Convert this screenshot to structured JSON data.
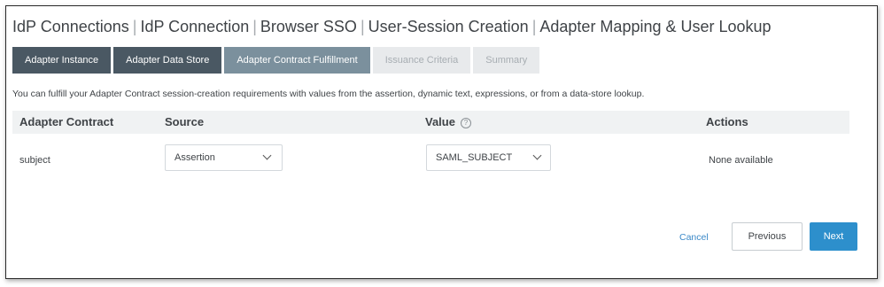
{
  "breadcrumb": {
    "items": [
      "IdP Connections",
      "IdP Connection",
      "Browser SSO",
      "User-Session Creation",
      "Adapter Mapping & User Lookup"
    ],
    "separator": "|"
  },
  "tabs": [
    {
      "label": "Adapter Instance",
      "state": "done"
    },
    {
      "label": "Adapter Data Store",
      "state": "done"
    },
    {
      "label": "Adapter Contract Fulfillment",
      "state": "active"
    },
    {
      "label": "Issuance Criteria",
      "state": "pending"
    },
    {
      "label": "Summary",
      "state": "pending"
    }
  ],
  "info_text": "You can fulfill your Adapter Contract session-creation requirements with values from the assertion, dynamic text, expressions, or from a data-store lookup.",
  "table": {
    "headers": {
      "contract": "Adapter Contract",
      "source": "Source",
      "value": "Value",
      "actions": "Actions"
    },
    "value_info_icon": "info-icon",
    "rows": [
      {
        "contract": "subject",
        "source": "Assertion",
        "value": "SAML_SUBJECT",
        "actions": "None available"
      }
    ]
  },
  "buttons": {
    "cancel": "Cancel",
    "previous": "Previous",
    "next": "Next"
  },
  "colors": {
    "tab_done": "#4a5863",
    "tab_active": "#7b909d",
    "tab_pending": "#e8eaec",
    "primary": "#2d8fcc",
    "link": "#3b89c8"
  }
}
